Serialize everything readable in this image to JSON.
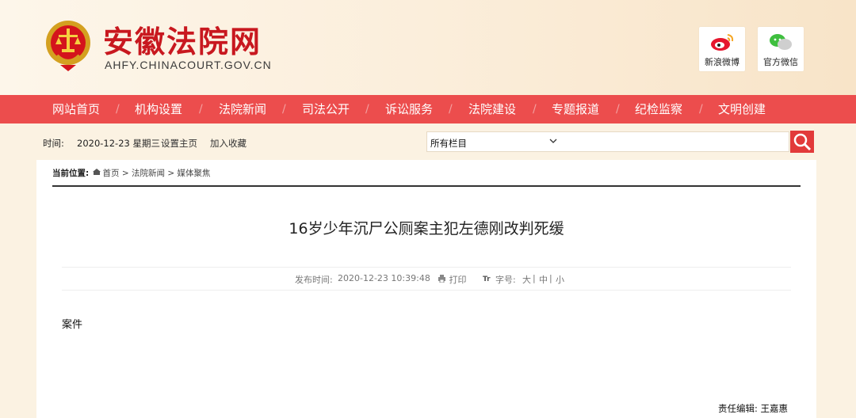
{
  "header": {
    "site_name": "安徽法院网",
    "site_domain": "AHFY.CHINACOURT.GOV.CN",
    "weibo_label": "新浪微博",
    "wechat_label": "官方微信"
  },
  "nav": {
    "items": [
      "网站首页",
      "机构设置",
      "法院新闻",
      "司法公开",
      "诉讼服务",
      "法院建设",
      "专题报道",
      "纪检监察",
      "文明创建"
    ],
    "separator": "/"
  },
  "infobar": {
    "time_label": "时间:",
    "date": "2020-12-23 星期三",
    "set_home": "设置主页",
    "add_fav": "加入收藏",
    "search_select": "所有栏目"
  },
  "breadcrumb": {
    "label": "当前位置:",
    "home": "首页",
    "section": "法院新闻",
    "subsection": "媒体聚焦",
    "sep": ">"
  },
  "article": {
    "title": "16岁少年沉尸公厕案主犯左德刚改判死缓",
    "publish_label": "发布时间:",
    "publish_time": "2020-12-23 10:39:48",
    "print": "打印",
    "font_label": "字号:",
    "font_large": "大",
    "font_mid": "中",
    "font_small": "小",
    "font_sep": "|",
    "body": "案件",
    "editor_label": "责任编辑:",
    "editor_name": "王嘉惠"
  },
  "colors": {
    "nav_bg": "#ec4d4d",
    "brand_red": "#c8181f",
    "page_bg": "#fbf2e2"
  }
}
